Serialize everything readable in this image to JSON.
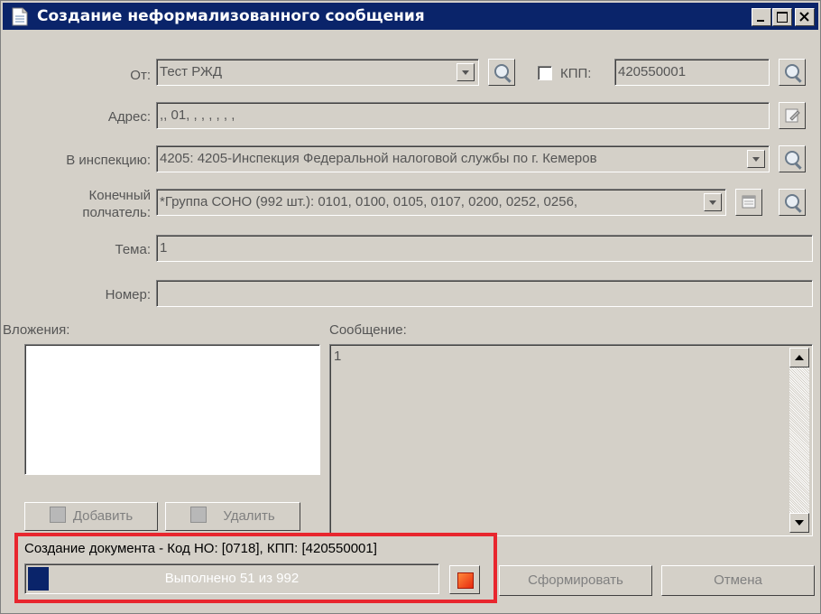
{
  "window": {
    "title": "Создание неформализованного сообщения"
  },
  "form": {
    "from_label": "От:",
    "from_value": "Тест РЖД",
    "kpp_label": "КПП:",
    "kpp_value": "420550001",
    "address_label": "Адрес:",
    "address_value": ",, 01, , , , , , ,",
    "inspection_label": "В инспекцию:",
    "inspection_value": "4205: 4205-Инспекция Федеральной налоговой службы по г. Кемеров",
    "recipient_label": "Конечный полчатель:",
    "recipient_value": "*Группа СОНО (992 шт.): 0101, 0100, 0105, 0107, 0200, 0252, 0256,",
    "subject_label": "Тема:",
    "subject_value": "1",
    "number_label": "Номер:",
    "number_value": ""
  },
  "attachments": {
    "label": "Вложения:",
    "add_label": "Добавить",
    "delete_label": "Удалить"
  },
  "message": {
    "label": "Сообщение:",
    "text": "1"
  },
  "status": {
    "line": "Создание документа - Код НО: [0718], КПП: [420550001]",
    "progress_text": "Выполнено 51 из 992",
    "progress_done": 51,
    "progress_total": 992
  },
  "buttons": {
    "generate_label": "Сформировать",
    "cancel_label": "Отмена"
  },
  "colors": {
    "highlight": "#e8262e",
    "titlebar": "#0a246a",
    "stop_icon": "#ff4a1a"
  }
}
